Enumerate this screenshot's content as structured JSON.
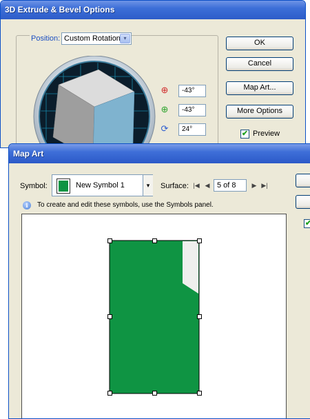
{
  "extrude_window": {
    "title": "3D Extrude & Bevel Options",
    "position_label": "Position:",
    "position_value": "Custom Rotation",
    "rotation": {
      "x": "-43°",
      "y": "-43°",
      "z": "24°"
    },
    "buttons": {
      "ok": "OK",
      "cancel": "Cancel",
      "map_art": "Map Art...",
      "more_options": "More Options"
    },
    "preview_label": "Preview",
    "preview_checked": true
  },
  "map_art_window": {
    "title": "Map Art",
    "symbol_label": "Symbol:",
    "symbol_value": "New Symbol 1",
    "surface_label": "Surface:",
    "surface_value": "5 of 8",
    "info_text": "To create and edit these symbols, use the Symbols panel.",
    "artwork_color": "#0f9443",
    "fold_color": "#efefed"
  },
  "icons": {
    "dropdown": "▾",
    "first": "|◀",
    "prev": "◀",
    "next": "▶",
    "last": "▶|",
    "check": "✔",
    "info": "i",
    "rot_x": "⊕",
    "rot_y": "⊕",
    "rot_z": "⟳"
  }
}
